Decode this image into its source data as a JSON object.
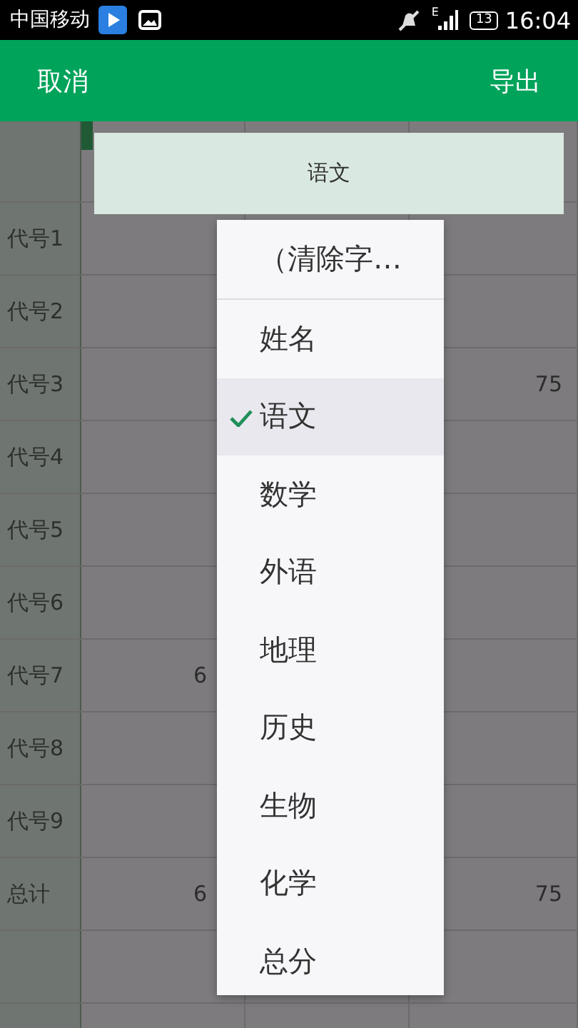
{
  "status_bar": {
    "carrier": "中国移动",
    "network": "E",
    "battery": "13",
    "time": "16:04"
  },
  "toolbar": {
    "cancel": "取消",
    "export": "导出"
  },
  "table": {
    "rows": [
      {
        "label": "代号1"
      },
      {
        "label": "代号2"
      },
      {
        "label": "代号3",
        "column_4": "75"
      },
      {
        "label": "代号4"
      },
      {
        "label": "代号5"
      },
      {
        "label": "代号6"
      },
      {
        "label": "代号7",
        "column_2": "6"
      },
      {
        "label": "代号8"
      },
      {
        "label": "代号9"
      },
      {
        "label": "总计",
        "column_2": "6",
        "column_4": "75"
      },
      {
        "label": null
      },
      {
        "label": null
      }
    ]
  },
  "column_header": "语文",
  "menu": [
    {
      "label": "（清除字…",
      "kind": "clear",
      "selected": false
    },
    {
      "label": "姓名",
      "kind": "field",
      "selected": false
    },
    {
      "label": "语文",
      "kind": "field",
      "selected": true
    },
    {
      "label": "数学",
      "kind": "field",
      "selected": false
    },
    {
      "label": "外语",
      "kind": "field",
      "selected": false
    },
    {
      "label": "地理",
      "kind": "field",
      "selected": false
    },
    {
      "label": "历史",
      "kind": "field",
      "selected": false
    },
    {
      "label": "生物",
      "kind": "field",
      "selected": false
    },
    {
      "label": "化学",
      "kind": "field",
      "selected": false
    },
    {
      "label": "总分",
      "kind": "field",
      "selected": false
    }
  ]
}
